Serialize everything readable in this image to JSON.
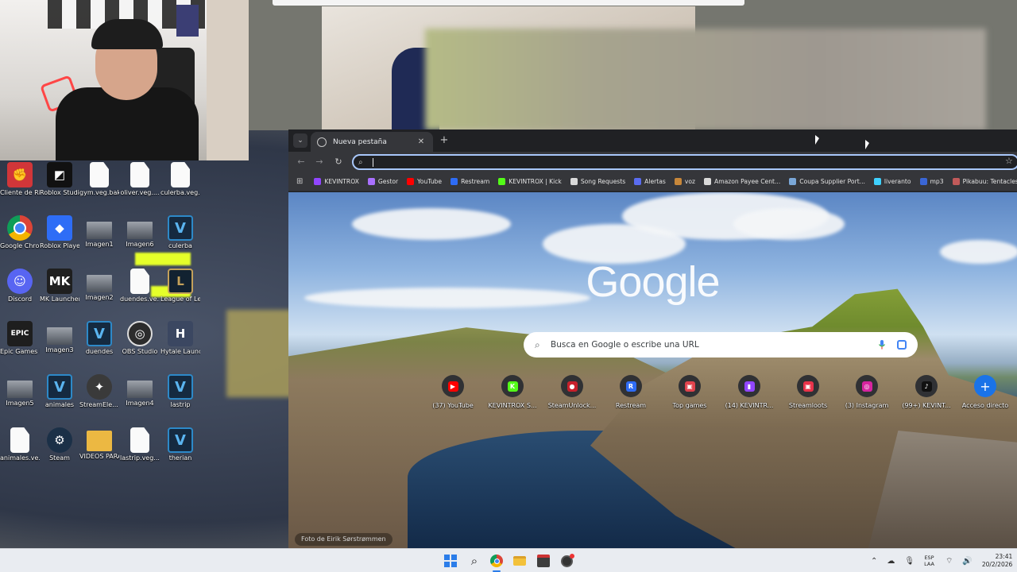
{
  "desktop": {
    "icons": [
      {
        "label": "Cliente de Riot",
        "icon": "riot-icon",
        "glyph": "✊"
      },
      {
        "label": "Roblox Studio",
        "icon": "roblox-studio-icon",
        "glyph": "◩"
      },
      {
        "label": "gym.veg.bak",
        "icon": "file-icon",
        "glyph": ""
      },
      {
        "label": "oliver.veg....",
        "icon": "file-icon",
        "glyph": ""
      },
      {
        "label": "culerba.veg....",
        "icon": "file-icon",
        "glyph": ""
      },
      {
        "label": "Google Chrome",
        "icon": "chrome-icon",
        "glyph": ""
      },
      {
        "label": "Roblox Player",
        "icon": "roblox-player-icon",
        "glyph": "◆"
      },
      {
        "label": "Imagen1",
        "icon": "image-icon",
        "glyph": ""
      },
      {
        "label": "Imagen6",
        "icon": "image-icon",
        "glyph": ""
      },
      {
        "label": "culerba",
        "icon": "vegas-icon",
        "glyph": "V"
      },
      {
        "label": "Discord",
        "icon": "discord-icon",
        "glyph": "☺"
      },
      {
        "label": "MK Launcher",
        "icon": "mk-launcher-icon",
        "glyph": "MK"
      },
      {
        "label": "Imagen2",
        "icon": "image-icon",
        "glyph": ""
      },
      {
        "label": "duendes.ve...",
        "icon": "file-icon",
        "glyph": ""
      },
      {
        "label": "League of Legends",
        "icon": "league-icon",
        "glyph": "L"
      },
      {
        "label": "Epic Games Launcher",
        "icon": "epic-games-icon",
        "glyph": "EPIC"
      },
      {
        "label": "Imagen3",
        "icon": "image-icon",
        "glyph": ""
      },
      {
        "label": "duendes",
        "icon": "vegas-icon",
        "glyph": "V"
      },
      {
        "label": "OBS Studio",
        "icon": "obs-icon",
        "glyph": "◎"
      },
      {
        "label": "Hytale Launcher",
        "icon": "hytale-icon",
        "glyph": "H"
      },
      {
        "label": "Imagen5",
        "icon": "image-icon",
        "glyph": ""
      },
      {
        "label": "animales",
        "icon": "vegas-icon",
        "glyph": "V"
      },
      {
        "label": "StreamEle... SE.Live",
        "icon": "streamelements-icon",
        "glyph": "✦"
      },
      {
        "label": "Imagen4",
        "icon": "image-icon",
        "glyph": ""
      },
      {
        "label": "lastrip",
        "icon": "vegas-icon",
        "glyph": "V"
      },
      {
        "label": "animales.ve...",
        "icon": "file-icon",
        "glyph": ""
      },
      {
        "label": "Steam",
        "icon": "steam-icon",
        "glyph": "⚙"
      },
      {
        "label": "VIDEOS PARA EDITAR",
        "icon": "folder-icon",
        "glyph": ""
      },
      {
        "label": "lastrip.veg....",
        "icon": "file-icon",
        "glyph": ""
      },
      {
        "label": "therian",
        "icon": "vegas-icon",
        "glyph": "V"
      }
    ]
  },
  "chrome": {
    "tab_title": "Nueva pestaña",
    "tab_close": "✕",
    "new_tab": "+",
    "tab_search": "⌄",
    "back": "←",
    "forward": "→",
    "reload": "↻",
    "omnibox_icon": "⌕",
    "star": "☆",
    "apps": "⊞",
    "bookmarks": [
      {
        "label": "KEVINTROX",
        "color": "#9146ff"
      },
      {
        "label": "Gestor",
        "color": "#a970ff"
      },
      {
        "label": "YouTube",
        "color": "#ff0000"
      },
      {
        "label": "Restream",
        "color": "#2e6cf6"
      },
      {
        "label": "KEVINTROX | Kick",
        "color": "#53fc18"
      },
      {
        "label": "Song Requests",
        "color": "#d9d9d9"
      },
      {
        "label": "Alertas",
        "color": "#5a6cf0"
      },
      {
        "label": "voz",
        "color": "#c7873a"
      },
      {
        "label": "Amazon Payee Cent...",
        "color": "#d9d9d9"
      },
      {
        "label": "Coupa Supplier Port...",
        "color": "#7aa7d8"
      },
      {
        "label": "liveranto",
        "color": "#3fd1ff"
      },
      {
        "label": "mp3",
        "color": "#3a66d6"
      },
      {
        "label": "Pikabuu: Tentacles...",
        "color": "#c15a5a"
      }
    ]
  },
  "ntp": {
    "logo": "Google",
    "search_placeholder": "Busca en Google o escribe una URL",
    "search_icon": "⌕",
    "shortcuts": [
      {
        "label": "(37) YouTube",
        "icon": "youtube-icon",
        "color": "#ff0000",
        "glyph": "▶"
      },
      {
        "label": "KEVINTROX S...",
        "icon": "kick-icon",
        "color": "#53fc18",
        "glyph": "K"
      },
      {
        "label": "SteamUnlock...",
        "icon": "steamunlocked-icon",
        "color": "#c8202b",
        "glyph": "●"
      },
      {
        "label": "Restream",
        "icon": "restream-icon",
        "color": "#2e6cf6",
        "glyph": "R"
      },
      {
        "label": "Top games",
        "icon": "topgames-icon",
        "color": "#e0434d",
        "glyph": "▣"
      },
      {
        "label": "(14) KEVINTR...",
        "icon": "twitch-icon",
        "color": "#9146ff",
        "glyph": "▮"
      },
      {
        "label": "Streamloots",
        "icon": "streamloots-icon",
        "color": "#e8334a",
        "glyph": "▣"
      },
      {
        "label": "(3) Instagram",
        "icon": "instagram-icon",
        "color": "#d6249f",
        "glyph": "◎"
      },
      {
        "label": "(99+) KEVINT...",
        "icon": "tiktok-icon",
        "color": "#111111",
        "glyph": "♪"
      }
    ],
    "add_shortcut_label": "Acceso directo",
    "add_shortcut_glyph": "+",
    "photo_credit": "Foto de Eirik Sørstrømmen"
  },
  "taskbar": {
    "search_glyph": "⌕",
    "tray_chevron": "⌃",
    "language_line1": "ESP",
    "language_line2": "LAA",
    "time": "23:41",
    "date": "20/2/2026",
    "notification_glyph": "🔔"
  }
}
